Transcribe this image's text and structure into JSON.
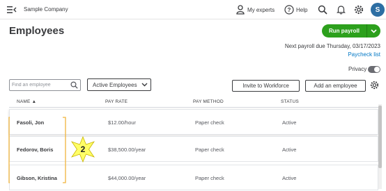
{
  "topbar": {
    "company": "Sample Company",
    "experts_label": "My experts",
    "help_label": "Help",
    "avatar_initial": "S"
  },
  "page": {
    "title": "Employees",
    "run_payroll_label": "Run payroll",
    "next_payroll_text": "Next payroll due Thursday, 03/17/2023",
    "paycheck_list_label": "Paycheck list",
    "privacy_label": "Privacy"
  },
  "toolbar": {
    "search_placeholder": "Find an employee",
    "filter_label": "Active Employees",
    "invite_label": "Invite to Workforce",
    "add_label": "Add an employee"
  },
  "table": {
    "headers": [
      "NAME ▲",
      "PAY RATE",
      "PAY METHOD",
      "STATUS"
    ],
    "rows": [
      {
        "name": "Fasoli, Jon",
        "rate": "$12.00/hour",
        "method": "Paper check",
        "status": "Active"
      },
      {
        "name": "Fedorov, Boris",
        "rate": "$38,500.00/year",
        "method": "Paper check",
        "status": "Active"
      },
      {
        "name": "Gibson, Kristina",
        "rate": "$44,000.00/year",
        "method": "Paper check",
        "status": "Active"
      }
    ]
  },
  "annotation": {
    "callout_number": "2",
    "bracket_color": "#f0b43c",
    "star_color": "#ffff66"
  },
  "colors": {
    "primary_green": "#2ca01c",
    "link_blue": "#0077c5",
    "text": "#393a3d"
  }
}
